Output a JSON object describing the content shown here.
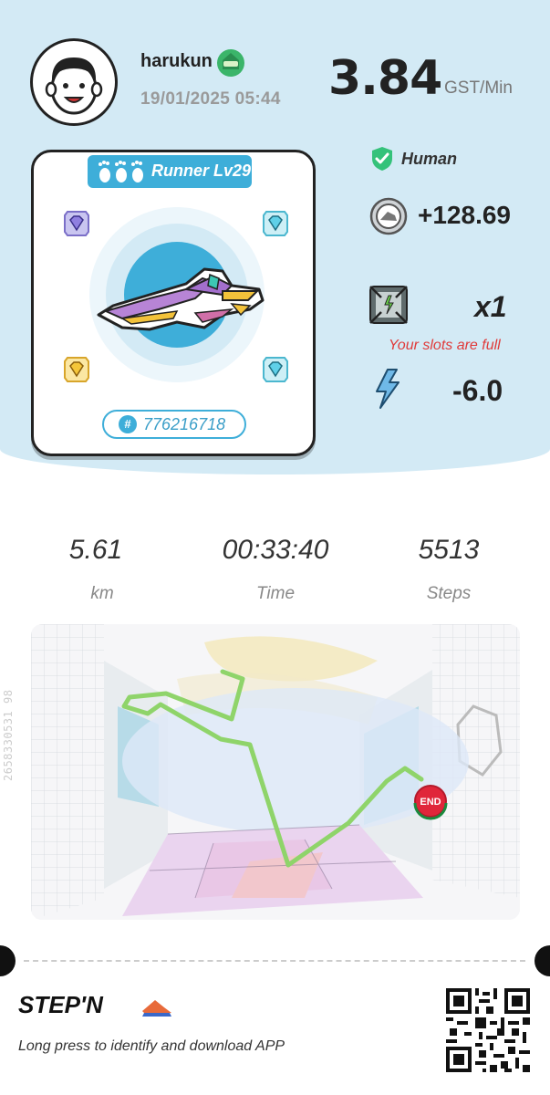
{
  "profile": {
    "username": "harukun",
    "datetime": "19/01/2025 05:44",
    "avatar_icon": "avatar-face-icon",
    "badge_icon": "green-badge-icon"
  },
  "earning": {
    "rate": "3.84",
    "unit": "GST/Min"
  },
  "sneaker": {
    "level_label": "Runner Lv29",
    "id_hash": "#",
    "id": "776216718"
  },
  "rewards": {
    "human_label": "Human",
    "gst_value": "+128.69",
    "mystery_box_count": "x1",
    "slots_message": "Your slots are full",
    "energy_value": "-6.0"
  },
  "stats": [
    {
      "value": "5.61",
      "label": "km"
    },
    {
      "value": "00:33:40",
      "label": "Time"
    },
    {
      "value": "5513",
      "label": "Steps"
    }
  ],
  "map": {
    "end_label": "END",
    "serial": "2658330531 98"
  },
  "footer": {
    "brand": "STEP'N",
    "tagline": "Long press to identify and download APP"
  },
  "colors": {
    "header_bg": "#d3eaf5",
    "accent_blue": "#3eaed9",
    "route_green": "#8fd46a",
    "warning_red": "#e03a3a",
    "end_red": "#e0263a"
  }
}
